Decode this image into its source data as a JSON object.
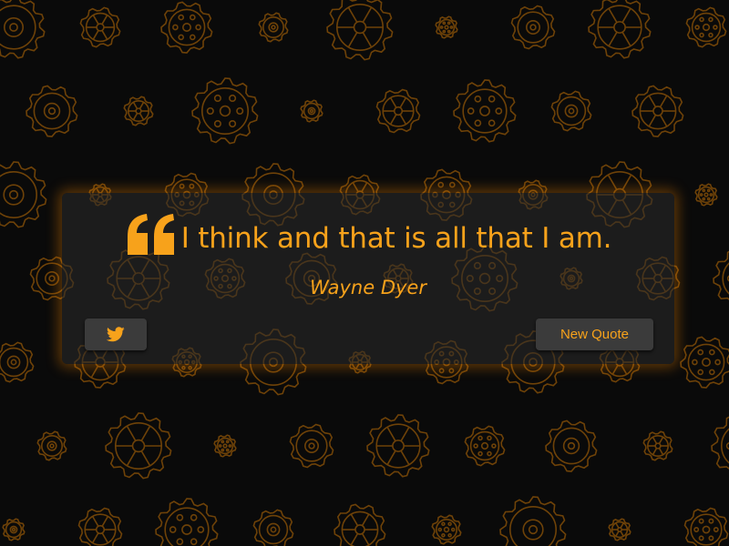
{
  "quote": {
    "text": "I think and that is all that I am.",
    "author": "Wayne Dyer"
  },
  "buttons": {
    "tweet_icon": "twitter-icon",
    "new_quote_label": "New Quote"
  },
  "background": {
    "pattern": "gear-pattern"
  },
  "colors": {
    "accent": "#f7a21b",
    "background": "#0a0a0a",
    "box": "#2c2c2c",
    "button": "#3b3b3b",
    "glow": "#ff8c00"
  }
}
